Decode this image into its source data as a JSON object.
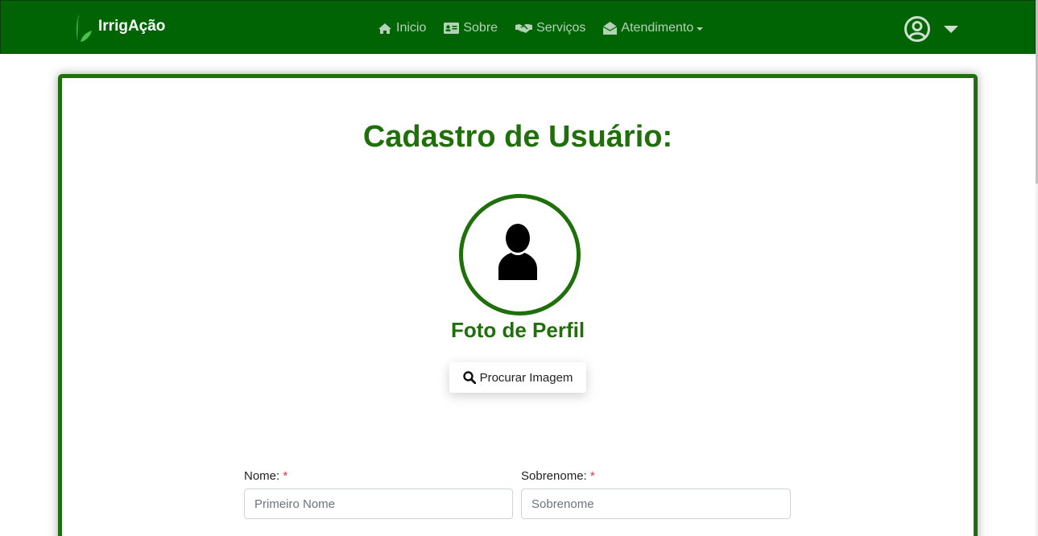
{
  "brand": {
    "name": "IrrigAção"
  },
  "nav": {
    "items": [
      {
        "label": "Inicio",
        "icon": "home-icon"
      },
      {
        "label": "Sobre",
        "icon": "id-card-icon"
      },
      {
        "label": "Serviços",
        "icon": "handshake-icon"
      },
      {
        "label": "Atendimento",
        "icon": "envelope-open-icon",
        "dropdown": true
      }
    ]
  },
  "user": {
    "icon": "user-circle-icon",
    "menu_icon": "caret-down-icon"
  },
  "page": {
    "title": "Cadastro de Usuário:",
    "photo": {
      "label": "Foto de Perfil",
      "icon": "user-silhouette-icon"
    },
    "browse_button": {
      "label": "Procurar Imagem",
      "icon": "search-icon"
    }
  },
  "form": {
    "first_name": {
      "label": "Nome:",
      "required_mark": "*",
      "placeholder": "Primeiro Nome",
      "value": ""
    },
    "last_name": {
      "label": "Sobrenome:",
      "required_mark": "*",
      "placeholder": "Sobrenome",
      "value": ""
    }
  },
  "colors": {
    "navbar": "#006405",
    "accent": "#1f6f0b",
    "required": "#dc3545"
  }
}
